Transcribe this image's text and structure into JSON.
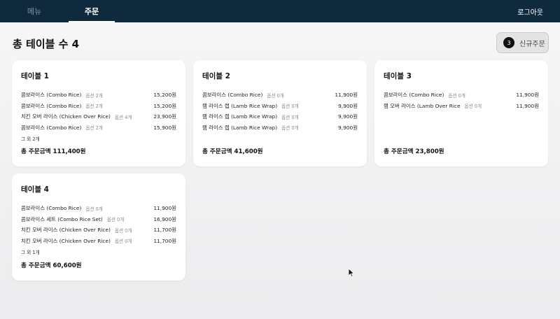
{
  "nav": {
    "menu_label": "메뉴",
    "orders_label": "주문",
    "logout_label": "로그아웃"
  },
  "header": {
    "title": "총 테이블 수 4",
    "new_order_count": "3",
    "new_order_label": "신규주문"
  },
  "tables": [
    {
      "title": "테이블 1",
      "items": [
        {
          "name": "콤보라이스 (Combo Rice)",
          "options": "옵션 2개",
          "price": "15,200원"
        },
        {
          "name": "콤보라이스 (Combo Rice)",
          "options": "옵션 2개",
          "price": "15,200원"
        },
        {
          "name": "치킨 오버 라이스 (Chicken Over Rice)",
          "options": "옵션 4개",
          "price": "23,900원"
        },
        {
          "name": "콤보라이스 (Combo Rice)",
          "options": "옵션 2개",
          "price": "15,900원"
        }
      ],
      "more": "그 외 2개",
      "total": "총 주문금액 111,400원"
    },
    {
      "title": "테이블 2",
      "items": [
        {
          "name": "콤보라이스 (Combo Rice)",
          "options": "옵션 0개",
          "price": "11,900원"
        },
        {
          "name": "램 라이스 랩 (Lamb Rice Wrap)",
          "options": "옵션 0개",
          "price": "9,900원"
        },
        {
          "name": "램 라이스 랩 (Lamb Rice Wrap)",
          "options": "옵션 0개",
          "price": "9,900원"
        },
        {
          "name": "램 라이스 랩 (Lamb Rice Wrap)",
          "options": "옵션 0개",
          "price": "9,900원"
        }
      ],
      "more": "",
      "total": "총 주문금액 41,600원"
    },
    {
      "title": "테이블 3",
      "items": [
        {
          "name": "콤보라이스 (Combo Rice)",
          "options": "옵션 0개",
          "price": "11,900원"
        },
        {
          "name": "램 오버 라이스 (Lamb Over Rice",
          "options": "옵션 0개",
          "price": "11,900원"
        }
      ],
      "more": "",
      "total": "총 주문금액 23,800원"
    },
    {
      "title": "테이블 4",
      "items": [
        {
          "name": "콤보라이스 (Combo Rice)",
          "options": "옵션 0개",
          "price": "11,900원"
        },
        {
          "name": "콤보라이스 세트 (Combo Rice Set)",
          "options": "옵션 0개",
          "price": "16,900원"
        },
        {
          "name": "치킨 오버 라이스 (Chicken Over Rice)",
          "options": "옵션 0개",
          "price": "11,700원"
        },
        {
          "name": "치킨 오버 라이스 (Chicken Over Rice)",
          "options": "옵션 0개",
          "price": "11,700원"
        }
      ],
      "more": "그 외 1개",
      "total": "총 주문금액 60,600원"
    }
  ]
}
